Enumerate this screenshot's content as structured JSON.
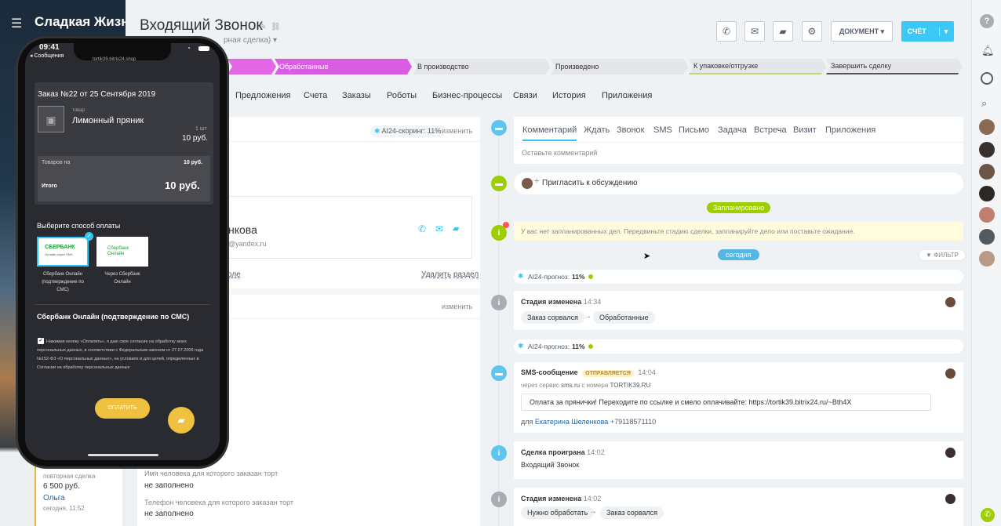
{
  "app": {
    "brand": "Сладкая Жизн"
  },
  "deal": {
    "title": "Входящий Звонок",
    "subtitle": "рная сделка)"
  },
  "toolbar": {
    "document_label": "ДОКУМЕНТ",
    "invoice_label": "СЧЁТ"
  },
  "stages": [
    {
      "label": "",
      "color": "#e366e5"
    },
    {
      "label": "Обработанные",
      "color": "#d85de0"
    },
    {
      "label": "В производство",
      "color": "#e4e6e9"
    },
    {
      "label": "Произведено",
      "color": "#e4e6e9"
    },
    {
      "label": "К упаковке/отгрузке",
      "color": "#e4e6e9"
    },
    {
      "label": "Завершить сделку",
      "color": "#e4e6e9"
    }
  ],
  "tabs": [
    "Предложения",
    "Счета",
    "Заказы",
    "Роботы",
    "Бизнес-процессы",
    "Связи",
    "История",
    "Приложения"
  ],
  "left": {
    "scoring": "AI24-скоринг: 11%",
    "change": "изменить",
    "contact_name": "нкова",
    "contact_email": "@yandex.ru",
    "field_link": "оле",
    "delete_section": "Удалить раздел",
    "change2": "изменить",
    "field1_label": "Имя человека для которого заказан торт",
    "field1_value": "не заполнено",
    "field2_label": "Телефон человека для которого заказан торт",
    "field2_value": "не заполнено"
  },
  "recent_deal": {
    "type": "повторная сделка",
    "amount": "6 500 руб.",
    "person": "Ольга",
    "time": "сегодня, 11:52"
  },
  "composer": {
    "tabs": [
      "Комментарий",
      "Ждать",
      "Звонок",
      "SMS",
      "Письмо",
      "Задача",
      "Встреча",
      "Визит",
      "Приложения"
    ],
    "placeholder": "Оставьте комментарий"
  },
  "timeline": {
    "invite": "Пригласить к обсуждению",
    "planned_badge": "Запланировано",
    "no_planned": "У вас нет запланированных дел. Передвиньте стадию сделки, запланируйте дело или поставьте ожидание.",
    "today_badge": "сегодня",
    "filter": "ФИЛЬТР",
    "forecast_label": "AI24-прогноз:",
    "forecast_value": "11%",
    "stage_changed_1": {
      "title": "Стадия изменена",
      "time": "14:34",
      "from": "Заказ сорвался",
      "to": "Обработанные"
    },
    "sms": {
      "title": "SMS-сообщение",
      "status": "ОТПРАВЛЯЕТСЯ",
      "time": "14:04",
      "via_a": "через сервис",
      "via_service": "sms.ru",
      "via_b": "с номера",
      "via_number": "TORTIK39.RU",
      "text": "Оплата за прянички! Переходите по ссылке и смело оплачивайте: https://tortik39.bitrix24.ru/~Bth4X",
      "for_label": "для",
      "for_name": "Екатерина Шеленкова",
      "for_phone": "+79118571110"
    },
    "lost": {
      "title": "Сделка проиграна",
      "time": "14:02",
      "body": "Входящий Звонок"
    },
    "stage_changed_2": {
      "title": "Стадия изменена",
      "time": "14:02",
      "from": "Нужно обработать",
      "to": "Заказ сорвался"
    }
  },
  "phone": {
    "time": "09:41",
    "back": "◂ Сообщения",
    "url": "tortik39.bitrix24.shop",
    "order_title": "Заказ №22 от 25 Сентября 2019",
    "item_type": "товар",
    "item_name": "Лимонный пряник",
    "item_qty": "1 шт",
    "item_price": "10 руб.",
    "goods_label": "Товаров на",
    "goods_value": "10 руб.",
    "total_label": "Итого",
    "total_value": "10 руб.",
    "pay_title": "Выберите способ оплаты",
    "sber_logo": "СБЕРБАНК",
    "sber_logo_sub": "Онлайн через SMS",
    "sber_logo2": "Сбербанк Онлайн",
    "method1": "Сбербанк Онлайн (подтверждение по СМС)",
    "method2": "Через Сбербанк Онлайн",
    "selected_method": "Сбербанк Онлайн (подтверждение по СМС)",
    "consent": "Нажимая кнопку «Оплатить», я даю свое согласие на обработку моих персональных данных, в соответствии с Федеральным законом от 27.07.2006 года №152-ФЗ «О персональных данных», на условиях и для целей, определенных в Согласии на обработку персональных данных",
    "pay_button": "ОПЛАТИТЬ"
  }
}
